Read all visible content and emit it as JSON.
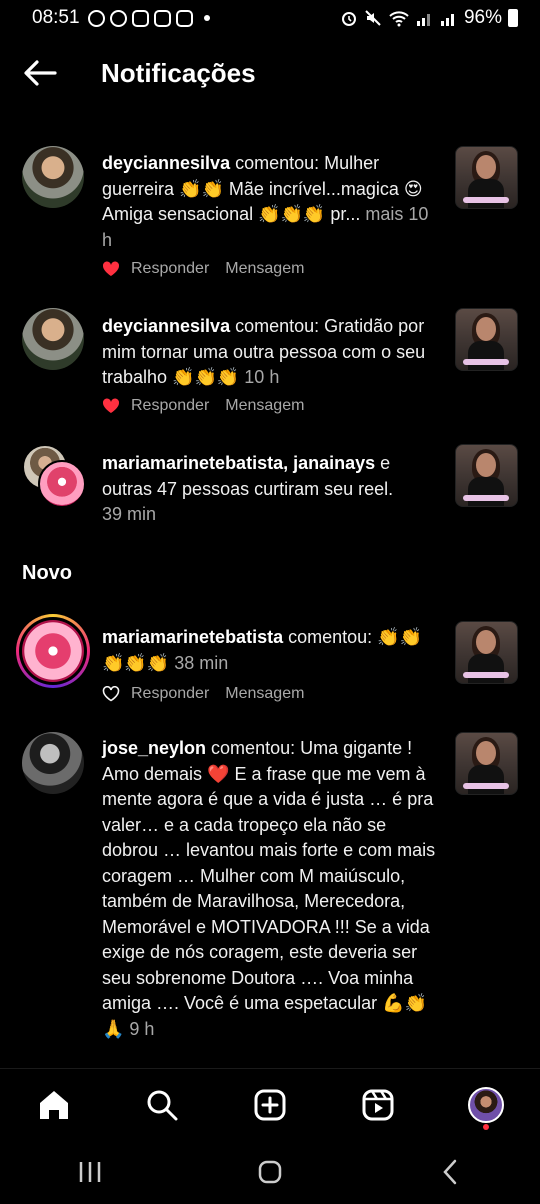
{
  "status_bar": {
    "time": "08:51",
    "battery": "96%"
  },
  "header": {
    "title": "Notificações"
  },
  "actions": {
    "reply": "Responder",
    "message": "Mensagem"
  },
  "notifications": [
    {
      "username": "deyciannesilva",
      "body": " comentou: Mulher guerreira 👏👏 Mãe incrível...magica 😍  Amiga sensacional 👏👏👏 pr... ",
      "more": "mais",
      "time": "10 h"
    },
    {
      "username": "deyciannesilva",
      "body": " comentou: Gratidão por mim tornar uma outra pessoa com o seu trabalho 👏👏👏 ",
      "time": "10 h"
    },
    {
      "username": "mariamarinetebatista",
      "sep": ", ",
      "username2": "janainays",
      "body": " e outras 47 pessoas curtiram seu reel.",
      "time": "39 min"
    }
  ],
  "section_new": "Novo",
  "new_notifications": [
    {
      "username": "mariamarinetebatista",
      "body": " comentou: 👏👏 👏👏👏 ",
      "time": "38 min"
    },
    {
      "username": "jose_neylon",
      "body": " comentou: Uma gigante ! Amo demais ❤️ E a frase que me vem à mente agora é que a vida é justa … é pra valer… e a cada tropeço ela não se dobrou … levantou mais forte e com mais coragem … Mulher com M maiúsculo, também de Maravilhosa, Merecedora, Memorável e MOTIVADORA !!! Se a vida exige de nós coragem, este deveria ser seu sobrenome Doutora …. Voa minha amiga …. Você é uma espetacular 💪👏🙏 ",
      "time": "9 h"
    }
  ]
}
